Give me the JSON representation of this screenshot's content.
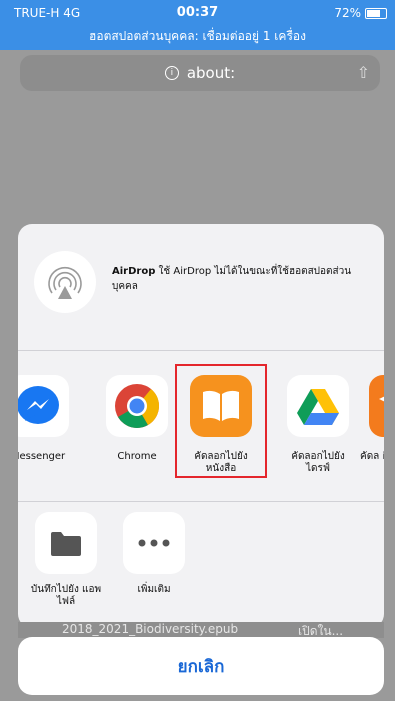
{
  "status_bar": {
    "carrier": "TRUE-H  4G",
    "time": "00:37",
    "battery": "72%",
    "battery_level": 0.72,
    "hotspot_text": "ฮอตสปอตส่วนบุคคล: เชื่อมต่ออยู่ 1 เครื่อง"
  },
  "address_bar": {
    "url": "about:"
  },
  "airdrop": {
    "title": "AirDrop",
    "message": " ใช้ AirDrop ไม่ได้ในขณะที่ใช้ฮอตสปอตส่วนบุคคล"
  },
  "share_apps": [
    {
      "label": "Messenger",
      "icon": "messenger-icon"
    },
    {
      "label": "Chrome",
      "icon": "chrome-icon"
    },
    {
      "label": "คัดลอกไปยัง หนังสือ",
      "icon": "books-icon"
    },
    {
      "label": "คัดลอกไปยัง ไดรฟ์",
      "icon": "google-drive-icon"
    },
    {
      "label": "คัดล iTu",
      "icon": "itunes-u-icon"
    }
  ],
  "share_actions": [
    {
      "label": "บันทึกไปยัง แอพไฟล์",
      "icon": "folder-icon"
    },
    {
      "label": "เพิ่มเติม",
      "icon": "more-dots-icon"
    }
  ],
  "background_row": {
    "filename": "2018_2021_Biodiversity.epub",
    "action": "เปิดใน..."
  },
  "cancel_label": "ยกเลิก",
  "colors": {
    "status_bar": "#3b8fe6",
    "cancel_text": "#1a68d6",
    "highlight_border": "#e4262c",
    "books_orange": "#f6921e"
  }
}
